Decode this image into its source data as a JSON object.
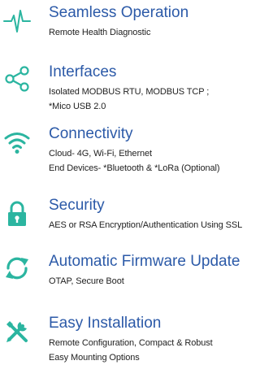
{
  "colors": {
    "title": "#2c5aa8",
    "icon": "#2bb5a0",
    "text": "#222222",
    "background": "#ffffff"
  },
  "features": [
    {
      "icon": "heartbeat-icon",
      "title": "Seamless Operation",
      "lines": [
        "Remote Health Diagnostic"
      ]
    },
    {
      "icon": "share-icon",
      "title": "Interfaces",
      "lines": [
        "Isolated MODBUS RTU, MODBUS TCP ;",
        "*Mico USB 2.0"
      ]
    },
    {
      "icon": "wifi-icon",
      "title": "Connectivity",
      "lines": [
        "Cloud- 4G, Wi-Fi, Ethernet",
        "End Devices- *Bluetooth & *LoRa (Optional)"
      ]
    },
    {
      "icon": "lock-icon",
      "title": "Security",
      "lines": [
        "AES or RSA Encryption/Authentication Using SSL"
      ]
    },
    {
      "icon": "refresh-icon",
      "title": "Automatic Firmware Update",
      "lines": [
        "OTAP, Secure Boot"
      ]
    },
    {
      "icon": "tools-icon",
      "title": "Easy Installation",
      "lines": [
        "Remote Configuration, Compact & Robust",
        "Easy Mounting Options"
      ]
    }
  ]
}
